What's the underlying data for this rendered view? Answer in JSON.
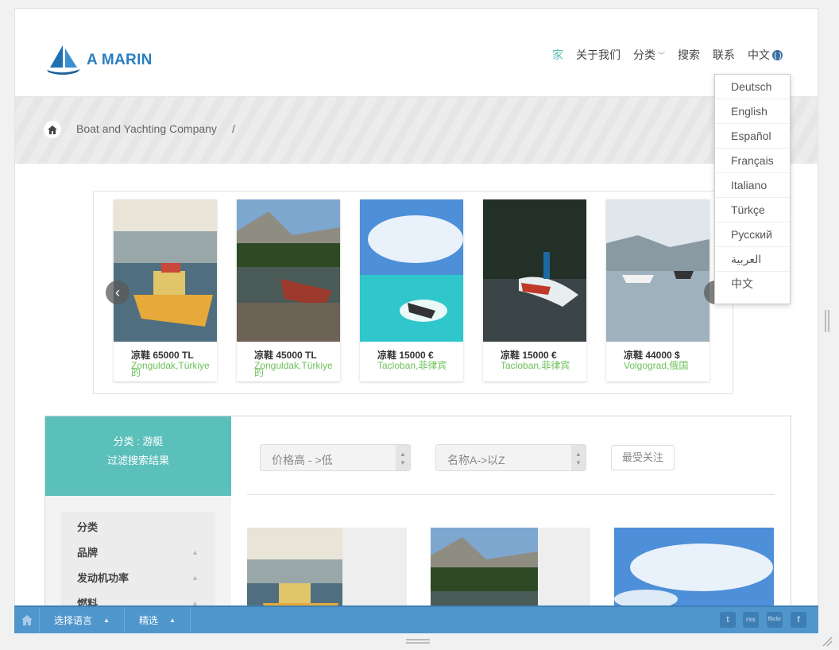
{
  "header": {
    "logo_text": "A MARIN",
    "nav": [
      "家",
      "关于我们",
      "分类",
      "搜索",
      "联系",
      "中文"
    ]
  },
  "breadcrumb": {
    "item": "Boat and Yachting Company",
    "separator": "/"
  },
  "language_menu": [
    "Deutsch",
    "English",
    "Español",
    "Français",
    "Italiano",
    "Türkçe",
    "Русский",
    "العربية",
    "中文"
  ],
  "carousel": {
    "cards": [
      {
        "price": "凉鞋 65000 TL",
        "location": "Zonguldak,Türkiye 的"
      },
      {
        "price": "凉鞋 45000 TL",
        "location": "Zonguldak,Türkiye 的"
      },
      {
        "price": "凉鞋 15000 €",
        "location": "Tacloban,菲律宾"
      },
      {
        "price": "凉鞋 15000 €",
        "location": "Tacloban,菲律宾"
      },
      {
        "price": "凉鞋 44000 $",
        "location": "Volgograd,俄国"
      }
    ]
  },
  "sidebar": {
    "category_line": "分类 : 游艇",
    "filter_title": "过滤搜索结果",
    "filters": [
      "分类",
      "品牌",
      "发动机功率",
      "燃料"
    ]
  },
  "sort": {
    "price_select": "价格高 - >低",
    "name_select": "名称A->以Z",
    "popular_button": "最受关注"
  },
  "bottombar": {
    "language": "选择语言",
    "featured": "精选",
    "social": [
      "t",
      "rss",
      "flickr",
      "f"
    ]
  },
  "colors": {
    "accent": "#5bbfba",
    "brand_blue": "#2a7ec0",
    "bar_blue": "#4f96cc",
    "location_green": "#6cc15a"
  }
}
